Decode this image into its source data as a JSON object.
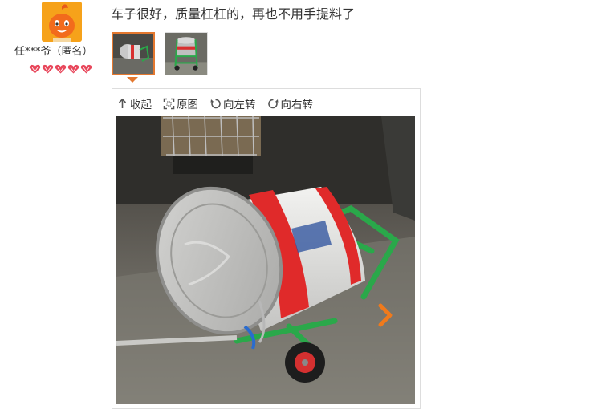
{
  "user": {
    "name": "任***爷（匿名）",
    "badge_count": 5,
    "badge_color": "#e8475b"
  },
  "review": {
    "text": "车子很好，质量杠杠的，再也不用手提料了"
  },
  "thumbnails": [
    {
      "selected": true
    },
    {
      "selected": false
    }
  ],
  "viewer": {
    "toolbar": {
      "collapse": "收起",
      "original": "原图",
      "rotate_left": "向左转",
      "rotate_right": "向右转"
    }
  },
  "colors": {
    "accent": "#e4782f",
    "avatar_bg": "#f6a21a",
    "cart_green": "#2aa84a",
    "bucket_red": "#e02a2a"
  }
}
